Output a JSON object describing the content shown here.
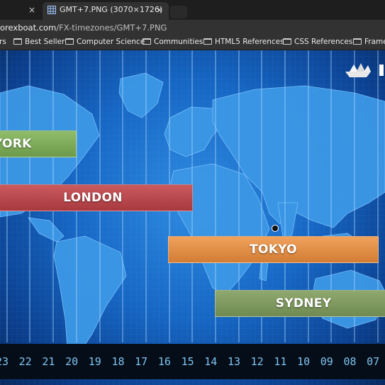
{
  "tabs": [
    {
      "title": "",
      "close": "×",
      "active": false
    },
    {
      "title": "GMT+7.PNG (3070×1726)",
      "close": "×",
      "active": true
    }
  ],
  "address": {
    "host": "orexboat.com",
    "path": "/FX-timezones/GMT+7.PNG"
  },
  "bookmarks": [
    "rs",
    "Best Seller",
    "Computer Science",
    "Communities",
    "HTML5 References",
    "CSS References",
    "Framew"
  ],
  "image": {
    "bars": [
      {
        "label": "YORK",
        "color": "#7aa957"
      },
      {
        "label": "LONDON",
        "color": "#b6464b"
      },
      {
        "label": "TOKYO",
        "color": "#e18d45"
      },
      {
        "label": "SYDNEY",
        "color": "#7d985f"
      }
    ],
    "hours": [
      "23",
      "22",
      "21",
      "20",
      "19",
      "18",
      "17",
      "16",
      "15",
      "14",
      "13",
      "12",
      "11",
      "10",
      "09",
      "08",
      "07",
      "0"
    ],
    "colors": {
      "ocean": "#1667c4",
      "land": "#3f9ae6",
      "hour_text": "#7fc4f0"
    }
  }
}
